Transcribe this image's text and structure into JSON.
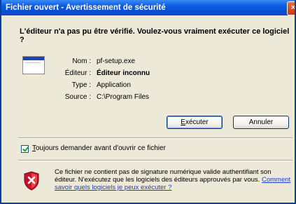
{
  "window": {
    "title": "Fichier ouvert - Avertissement de sécurité",
    "close_symbol": "×"
  },
  "question": "L'éditeur n'a pas pu être vérifié. Voulez-vous vraiment exécuter ce logiciel ?",
  "file_icon": "application-window-icon",
  "details": [
    {
      "label": "Nom :",
      "value": "pf-setup.exe",
      "bold": false
    },
    {
      "label": "Éditeur :",
      "value": "Éditeur inconnu",
      "bold": true
    },
    {
      "label": "Type :",
      "value": "Application",
      "bold": false
    },
    {
      "label": "Source :",
      "value": "C:\\Program Files",
      "bold": false
    }
  ],
  "buttons": {
    "execute": {
      "accel": "E",
      "rest": "xécuter"
    },
    "cancel": {
      "label": "Annuler"
    }
  },
  "checkbox": {
    "checked": true,
    "accel": "T",
    "rest": "oujours demander avant d'ouvrir ce fichier"
  },
  "warning": {
    "icon": "shield-warning-icon",
    "text": "Ce fichier ne contient pas de signature numérique valide authentifiant son éditeur. N'exécutez que les logiciels des éditeurs approuvés par vous.",
    "link": "Comment savoir quels logiciels je peux exécuter ?"
  },
  "colors": {
    "titlebar": "#0b5ae0",
    "dialog_background": "#ece9d8",
    "shield_red": "#c8102e",
    "link": "#1a3fc8"
  }
}
